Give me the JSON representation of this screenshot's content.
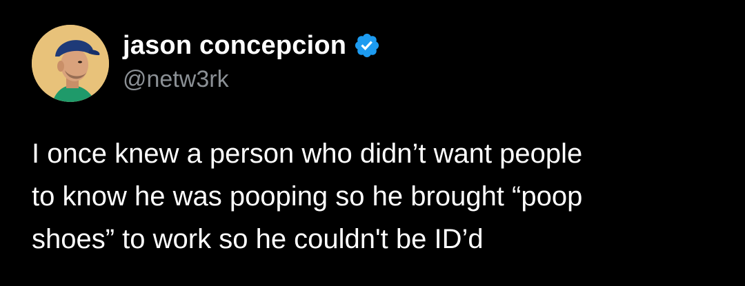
{
  "author": {
    "display_name": "jason concepcion",
    "handle": "@netw3rk",
    "verified_icon": "verified-badge-icon",
    "avatar_icon": "profile-photo"
  },
  "tweet": {
    "lines": [
      "I once knew a person who didn’t want people",
      "to know he was pooping so he brought “poop",
      "shoes” to work so he couldn't be ID’d"
    ]
  },
  "colors": {
    "background": "#000000",
    "text": "#ffffff",
    "handle": "#8b9095",
    "verified": "#1d9bf0",
    "avatar_background": "#e8c27a"
  }
}
